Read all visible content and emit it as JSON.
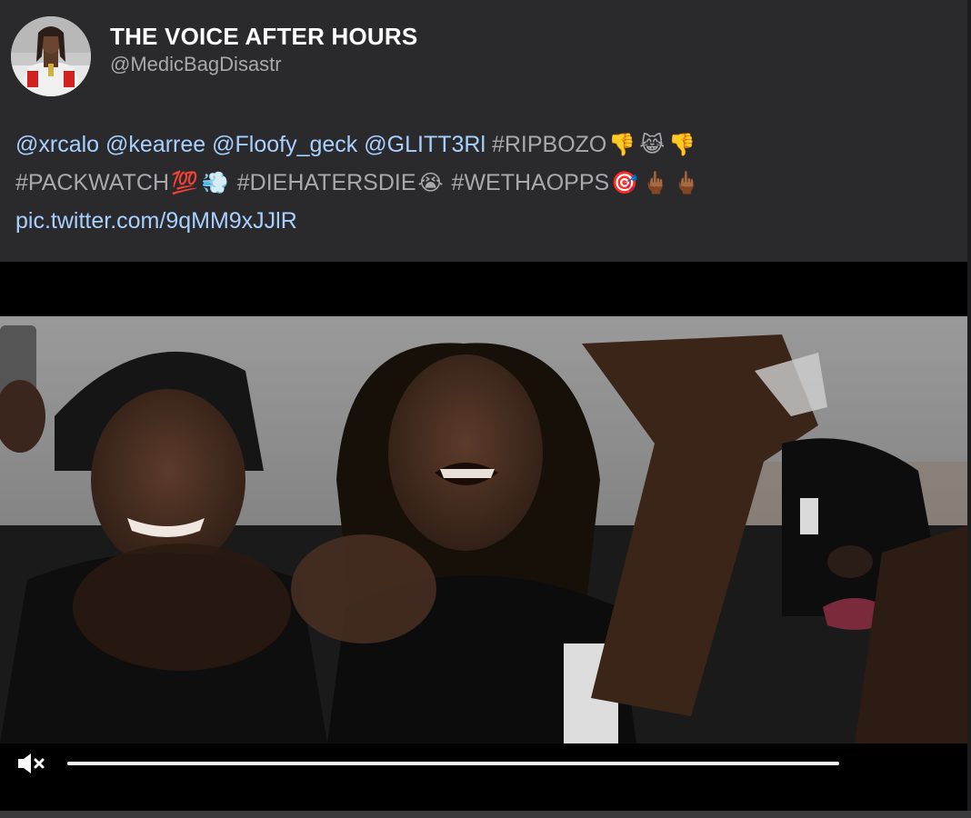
{
  "tweet": {
    "display_name": "THE VOICE AFTER HOURS",
    "handle": "@MedicBagDisastr",
    "avatar_icon": "profile-avatar",
    "text": {
      "mentions": [
        "@xrcalo",
        "@kearree",
        "@Floofy_geck",
        "@GLITT3Rl"
      ],
      "hashtag_1": "#RIPBOZO",
      "hashtag_2": "#PACKWATCH",
      "hashtag_3": "#DIEHATERSDIE",
      "hashtag_4": "#WETHAOPPS",
      "link": "pic.twitter.com/9qMM9xJJlR",
      "emoji_thumbs_down": "👎",
      "emoji_laughing_cat": "😹",
      "emoji_hundred": "💯",
      "emoji_dash": "💨",
      "emoji_crying": "😭",
      "emoji_target": "🎯",
      "emoji_middle_finger": "🖕🏾"
    }
  },
  "video": {
    "muted": true,
    "mute_icon": "speaker-muted-icon",
    "progress": 1.0
  },
  "colors": {
    "background": "#2a2a2c",
    "mention": "#a8d0ff",
    "hashtag": "#a9a9ad",
    "video_bg": "#000000"
  }
}
